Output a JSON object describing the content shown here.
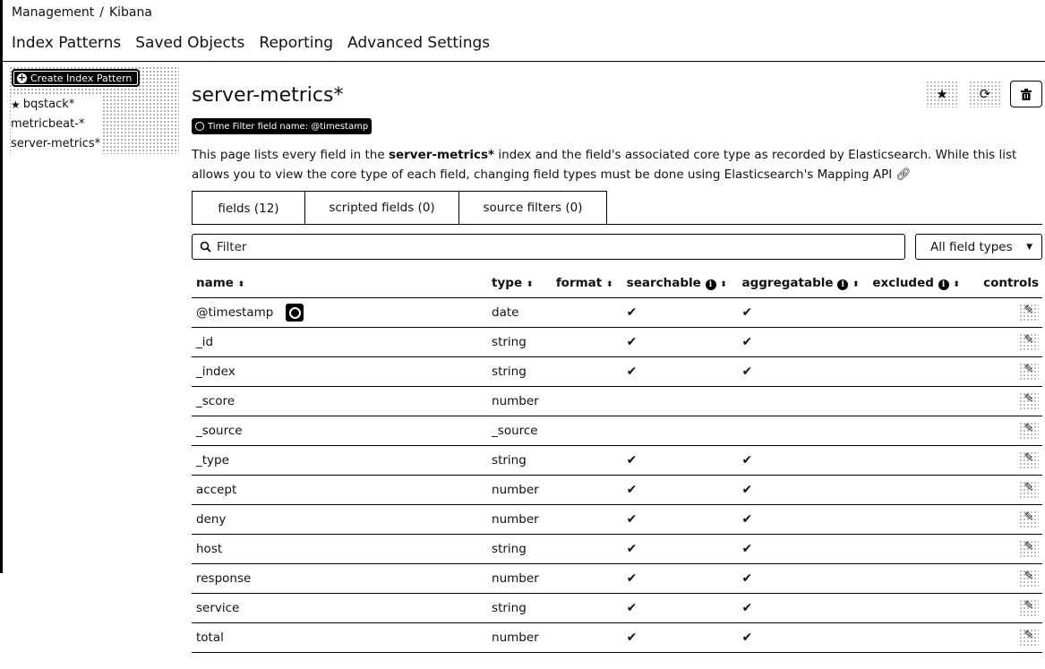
{
  "breadcrumb": [
    "Management",
    "/",
    "Kibana"
  ],
  "topnav": [
    "Index Patterns",
    "Saved Objects",
    "Reporting",
    "Advanced Settings"
  ],
  "sidebar": {
    "create_label": "Create Index Pattern",
    "items": [
      {
        "label": "bqstack*",
        "starred": true
      },
      {
        "label": "metricbeat-*",
        "starred": false
      },
      {
        "label": "server-metrics*",
        "starred": false
      }
    ]
  },
  "page": {
    "title": "server-metrics*",
    "time_badge": "Time Filter field name: @timestamp",
    "desc_1": "This page lists every field in the ",
    "desc_bold": "server-metrics*",
    "desc_2": " index and the field's associated core type as recorded by Elasticsearch. While this list allows you to view the core type of each field, changing field types must be done using Elasticsearch's ",
    "desc_link": "Mapping API"
  },
  "tabs": [
    "fields (12)",
    "scripted fields (0)",
    "source filters (0)"
  ],
  "filter": {
    "placeholder": "Filter"
  },
  "type_select": {
    "value": "All field types"
  },
  "columns": [
    "name",
    "type",
    "format",
    "searchable",
    "aggregatable",
    "excluded",
    "controls"
  ],
  "fields": [
    {
      "name": "@timestamp",
      "type": "date",
      "searchable": "✔",
      "aggregatable": "✔"
    },
    {
      "name": "_id",
      "type": "string",
      "searchable": "✔",
      "aggregatable": "✔"
    },
    {
      "name": "_index",
      "type": "string",
      "searchable": "✔",
      "aggregatable": "✔"
    },
    {
      "name": "_score",
      "type": "number",
      "searchable": "",
      "aggregatable": ""
    },
    {
      "name": "_source",
      "type": "_source",
      "searchable": "",
      "aggregatable": ""
    },
    {
      "name": "_type",
      "type": "string",
      "searchable": "✔",
      "aggregatable": "✔"
    },
    {
      "name": "accept",
      "type": "number",
      "searchable": "✔",
      "aggregatable": "✔"
    },
    {
      "name": "deny",
      "type": "number",
      "searchable": "✔",
      "aggregatable": "✔"
    },
    {
      "name": "host",
      "type": "string",
      "searchable": "✔",
      "aggregatable": "✔"
    },
    {
      "name": "response",
      "type": "number",
      "searchable": "✔",
      "aggregatable": "✔"
    },
    {
      "name": "service",
      "type": "string",
      "searchable": "✔",
      "aggregatable": "✔"
    },
    {
      "name": "total",
      "type": "number",
      "searchable": "✔",
      "aggregatable": "✔"
    }
  ]
}
